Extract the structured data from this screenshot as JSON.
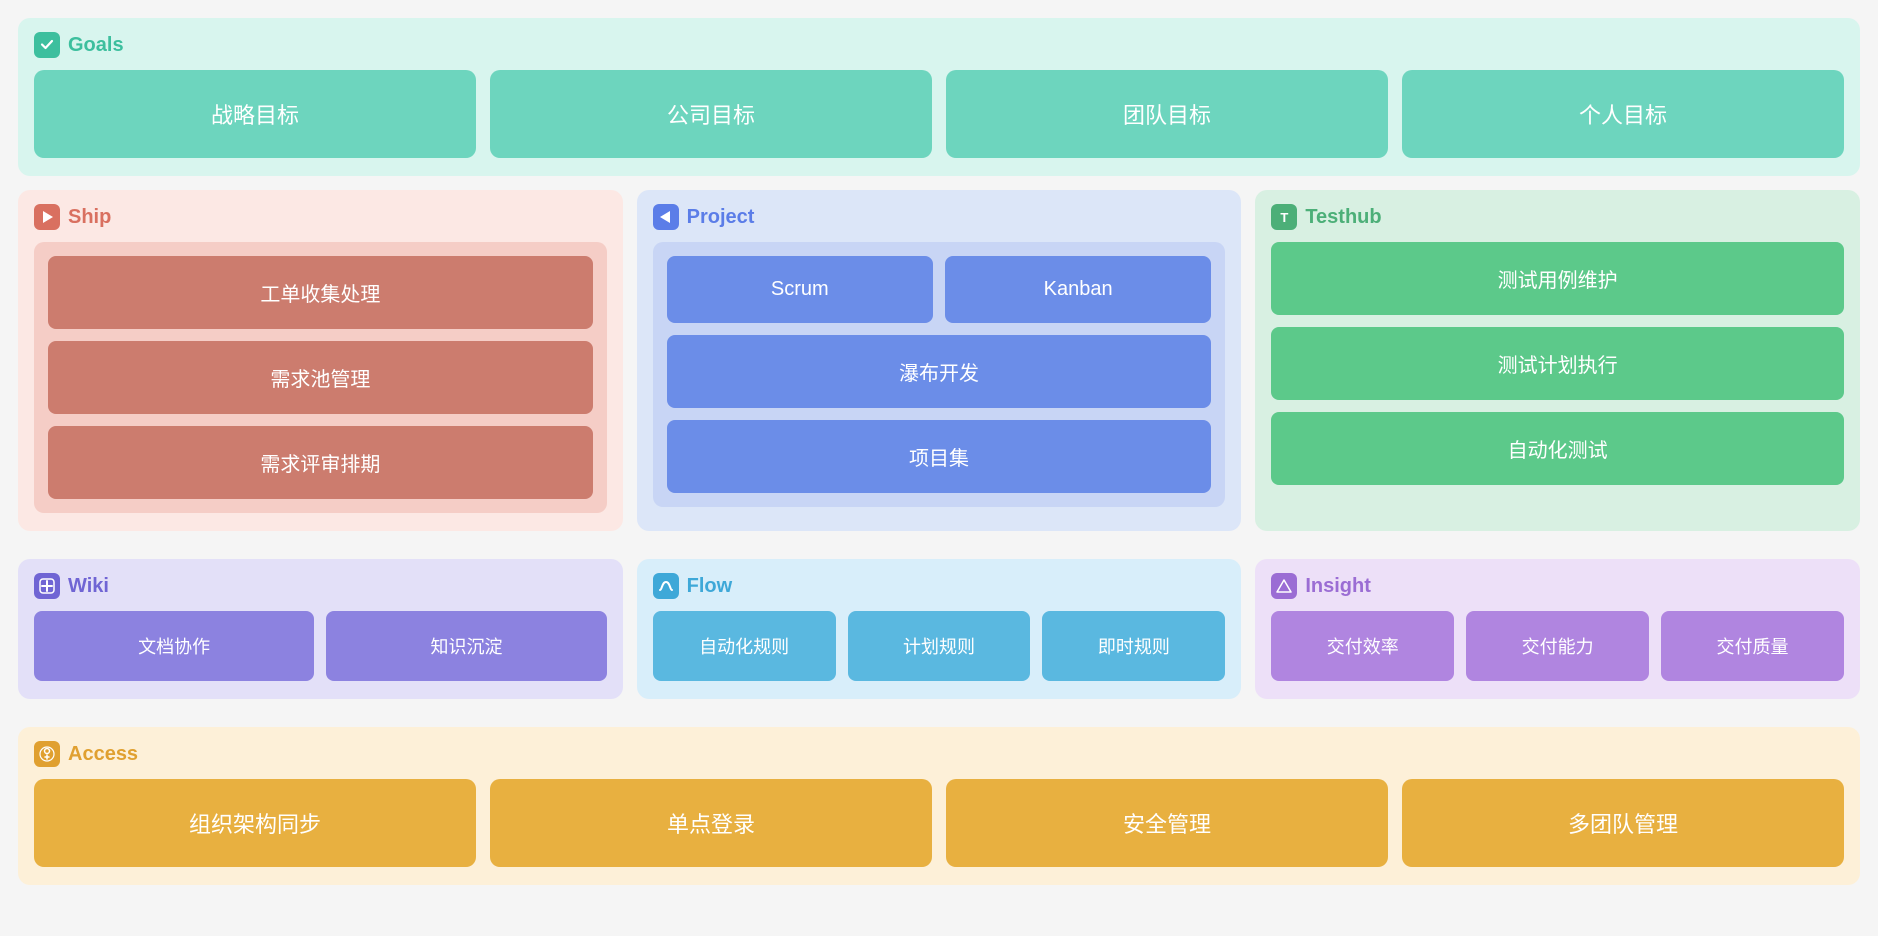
{
  "goals": {
    "title": "Goals",
    "icon": "✓",
    "icon_bg": "#3dbf9e",
    "cards": [
      "战略目标",
      "公司目标",
      "团队目标",
      "个人目标"
    ]
  },
  "ship": {
    "title": "Ship",
    "icon": "▷",
    "icon_bg": "#d97060",
    "cards": [
      "工单收集处理",
      "需求池管理",
      "需求评审排期"
    ]
  },
  "project": {
    "title": "Project",
    "icon": "◁",
    "icon_bg": "#5b7de8",
    "top_cards": [
      "Scrum",
      "Kanban"
    ],
    "bottom_cards": [
      "瀑布开发",
      "项目集"
    ]
  },
  "testhub": {
    "title": "Testhub",
    "icon": "T",
    "icon_bg": "#4caf78",
    "cards": [
      "测试用例维护",
      "测试计划执行",
      "自动化测试"
    ]
  },
  "wiki": {
    "title": "Wiki",
    "icon": "€",
    "icon_bg": "#7065d4",
    "cards": [
      "文档协作",
      "知识沉淀"
    ]
  },
  "flow": {
    "title": "Flow",
    "icon": "N",
    "icon_bg": "#3ea8d8",
    "cards": [
      "自动化规则",
      "计划规则",
      "即时规则"
    ]
  },
  "insight": {
    "title": "Insight",
    "icon": "Λ",
    "icon_bg": "#9b6dd4",
    "cards": [
      "交付效率",
      "交付能力",
      "交付质量"
    ]
  },
  "access": {
    "title": "Access",
    "icon": "?",
    "icon_bg": "#e0a030",
    "cards": [
      "组织架构同步",
      "单点登录",
      "安全管理",
      "多团队管理"
    ]
  }
}
